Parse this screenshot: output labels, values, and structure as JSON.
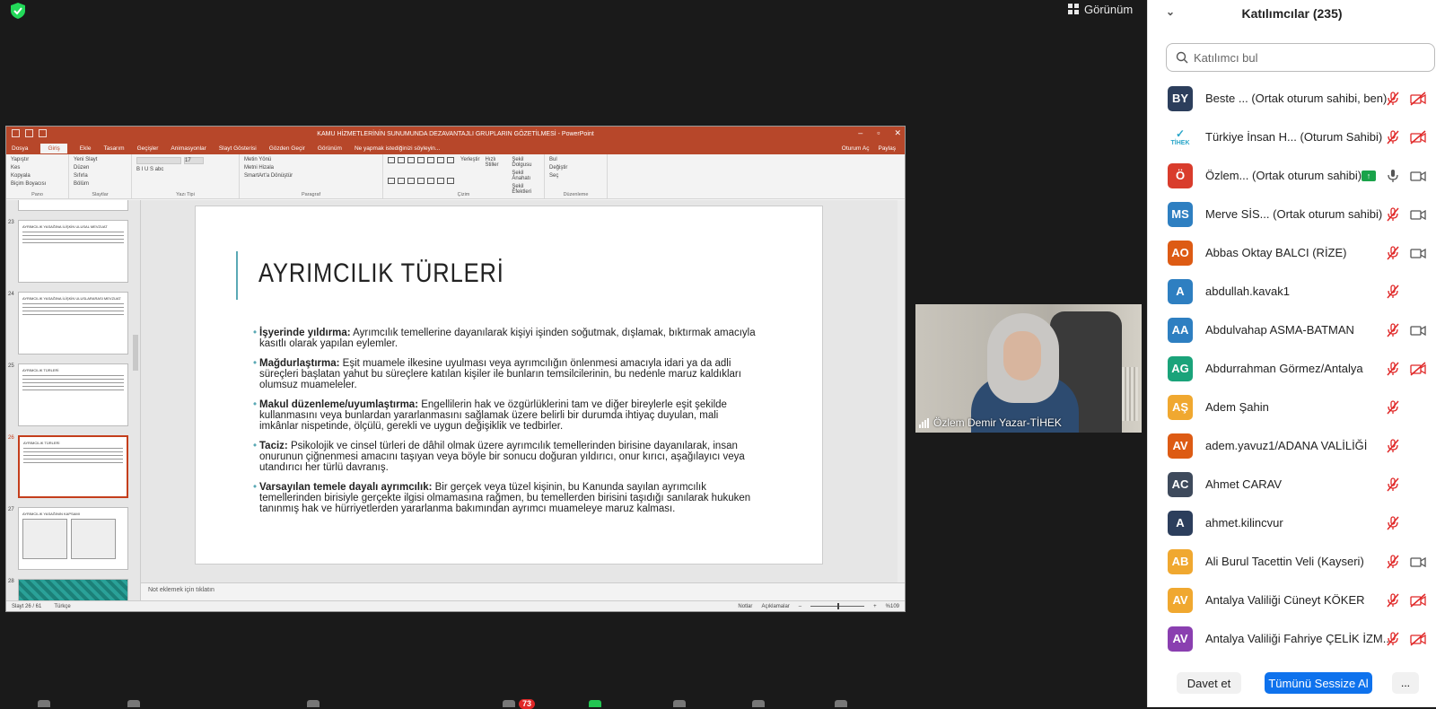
{
  "view_label": "Görünüm",
  "ppt": {
    "title": "KAMU HİZMETLERİNİN SUNUMUNDA DEZAVANTAJLI GRUPLARIN GÖZETİLMESİ - PowerPoint",
    "tabs": [
      "Dosya",
      "Giriş",
      "Ekle",
      "Tasarım",
      "Geçişler",
      "Animasyonlar",
      "Slayt Gösterisi",
      "Gözden Geçir",
      "Görünüm",
      "Ne yapmak istediğinizi söyleyin..."
    ],
    "tab_right": [
      "Oturum Aç",
      "Paylaş"
    ],
    "ribbon": {
      "clipboard": [
        "Yapıştır",
        "Kes",
        "Kopyala",
        "Biçim Boyacısı",
        "Pano"
      ],
      "slides": [
        "Yeni Slayt",
        "Düzen",
        "Sıfırla",
        "Bölüm",
        "Slaytlar"
      ],
      "font": [
        "Yazı Tipi",
        "17"
      ],
      "paragraph": [
        "Metin Yönü",
        "Metni Hizala",
        "SmartArt'a Dönüştür",
        "Paragraf"
      ],
      "drawing": [
        "Yerleştir",
        "Hızlı Stiller",
        "Şekil Dolgusu",
        "Şekil Anahatı",
        "Şekil Efektleri",
        "Çizim"
      ],
      "editing": [
        "Bul",
        "Değiştir",
        "Seç",
        "Düzenleme"
      ]
    },
    "thumbs": [
      {
        "num": "23",
        "title": "AYRIMCILIK YASAĞINA İLİŞKİN ULUSAL MEVZUAT"
      },
      {
        "num": "24",
        "title": "AYRIMCILIK YASAĞINA İLİŞKİN ULUSLARARASI MEVZUAT"
      },
      {
        "num": "25",
        "title": "AYRIMCILIK TÜRLERİ"
      },
      {
        "num": "26",
        "title": "AYRIMCILIK TÜRLERİ"
      },
      {
        "num": "27",
        "title": "AYRIMCILIK YASAĞININ KAPSAMI"
      },
      {
        "num": "28",
        "title": ""
      }
    ],
    "slide": {
      "title": "AYRIMCILIK TÜRLERİ",
      "bullets": [
        {
          "term": "İşyerinde yıldırma:",
          "text": " Ayrımcılık temellerine dayanılarak kişiyi işinden soğutmak, dışlamak, bıktırmak amacıyla kasıtlı olarak yapılan eylemler."
        },
        {
          "term": "Mağdurlaştırma:",
          "text": " Eşit muamele ilkesine uyulması veya ayrımcılığın önlenmesi amacıyla idari ya da adli süreçleri başlatan yahut bu süreçlere katılan kişiler ile bunların temsilcilerinin, bu nedenle maruz kaldıkları olumsuz muameleler."
        },
        {
          "term": "Makul düzenleme/uyumlaştırma:",
          "text": " Engellilerin hak ve özgürlüklerini tam ve diğer bireylerle eşit şekilde kullanmasını veya bunlardan yararlanmasını sağlamak üzere belirli bir durumda ihtiyaç duyulan, mali imkânlar nispetinde, ölçülü, gerekli ve uygun değişiklik ve tedbirler."
        },
        {
          "term": "Taciz:",
          "text": " Psikolojik ve cinsel türleri de dâhil olmak üzere ayrımcılık temellerinden birisine dayanılarak, insan onurunun çiğnenmesi amacını taşıyan veya böyle bir sonucu doğuran yıldırıcı, onur kırıcı, aşağılayıcı veya utandırıcı her türlü davranış."
        },
        {
          "term": "Varsayılan temele dayalı ayrımcılık:",
          "text": " Bir gerçek veya tüzel kişinin, bu Kanunda sayılan ayrımcılık temellerinden birisiyle gerçekte ilgisi olmamasına rağmen, bu temellerden birisini taşıdığı sanılarak hukuken tanınmış hak ve hürriyetlerden yararlanma bakımından ayrımcı muameleye maruz kalması."
        }
      ]
    },
    "notes_placeholder": "Not eklemek için tıklatın",
    "status": {
      "slide": "Slayt 26 / 61",
      "lang": "Türkçe",
      "notes": "Notlar",
      "comments": "Açıklamalar",
      "zoom": "%109"
    }
  },
  "video": {
    "name": "Özlem Demir Yazar-TİHEK"
  },
  "badge_count": "73",
  "panel": {
    "title": "Katılımcılar (235)",
    "search_placeholder": "Katılımcı bul",
    "participants": [
      {
        "initials": "BY",
        "color": "#2c3e5c",
        "name": "Beste ...",
        "role": "(Ortak oturum sahibi, ben)",
        "mic": "muted",
        "cam": "off"
      },
      {
        "initials": "",
        "color": "#ffffff",
        "name": "Türkiye İnsan H...",
        "role": "(Oturum Sahibi)",
        "mic": "muted",
        "cam": "off",
        "logo": "TİHEK"
      },
      {
        "initials": "Ö",
        "color": "#d93c2c",
        "name": "Özlem...",
        "role": "(Ortak oturum sahibi)",
        "mic": "on",
        "cam": "on",
        "share": true
      },
      {
        "initials": "MS",
        "color": "#2e7fc1",
        "name": "Merve SİS...",
        "role": "(Ortak oturum sahibi)",
        "mic": "muted",
        "cam": "on"
      },
      {
        "initials": "AO",
        "color": "#dd5b14",
        "name": "Abbas Oktay BALCI (RİZE)",
        "role": "",
        "mic": "muted",
        "cam": "on"
      },
      {
        "initials": "A",
        "color": "#2e7fc1",
        "name": "abdullah.kavak1",
        "role": "",
        "mic": "muted",
        "cam": ""
      },
      {
        "initials": "AA",
        "color": "#2e7fc1",
        "name": "Abdulvahap ASMA-BATMAN",
        "role": "",
        "mic": "muted",
        "cam": "on"
      },
      {
        "initials": "AG",
        "color": "#1aa37a",
        "name": "Abdurrahman Görmez/Antalya",
        "role": "",
        "mic": "muted",
        "cam": "off"
      },
      {
        "initials": "AŞ",
        "color": "#f0a830",
        "name": "Adem Şahin",
        "role": "",
        "mic": "muted",
        "cam": ""
      },
      {
        "initials": "AV",
        "color": "#dd5b14",
        "name": "adem.yavuz1/ADANA VALİLİĞİ",
        "role": "",
        "mic": "muted",
        "cam": ""
      },
      {
        "initials": "AC",
        "color": "#3e4a5c",
        "name": "Ahmet CARAV",
        "role": "",
        "mic": "muted",
        "cam": ""
      },
      {
        "initials": "A",
        "color": "#2c3e5c",
        "name": "ahmet.kilincvur",
        "role": "",
        "mic": "muted",
        "cam": ""
      },
      {
        "initials": "AB",
        "color": "#f0a830",
        "name": "Ali Burul Tacettin Veli (Kayseri)",
        "role": "",
        "mic": "muted",
        "cam": "on"
      },
      {
        "initials": "AV",
        "color": "#f0a830",
        "name": "Antalya Valiliği Cüneyt KÖKER",
        "role": "",
        "mic": "muted",
        "cam": "off"
      },
      {
        "initials": "AV",
        "color": "#8a3fb0",
        "name": "Antalya Valiliği Fahriye ÇELİK İZM...",
        "role": "",
        "mic": "muted",
        "cam": "off"
      }
    ],
    "invite_label": "Davet et",
    "mute_all_label": "Tümünü Sessize Al",
    "more_label": "..."
  }
}
